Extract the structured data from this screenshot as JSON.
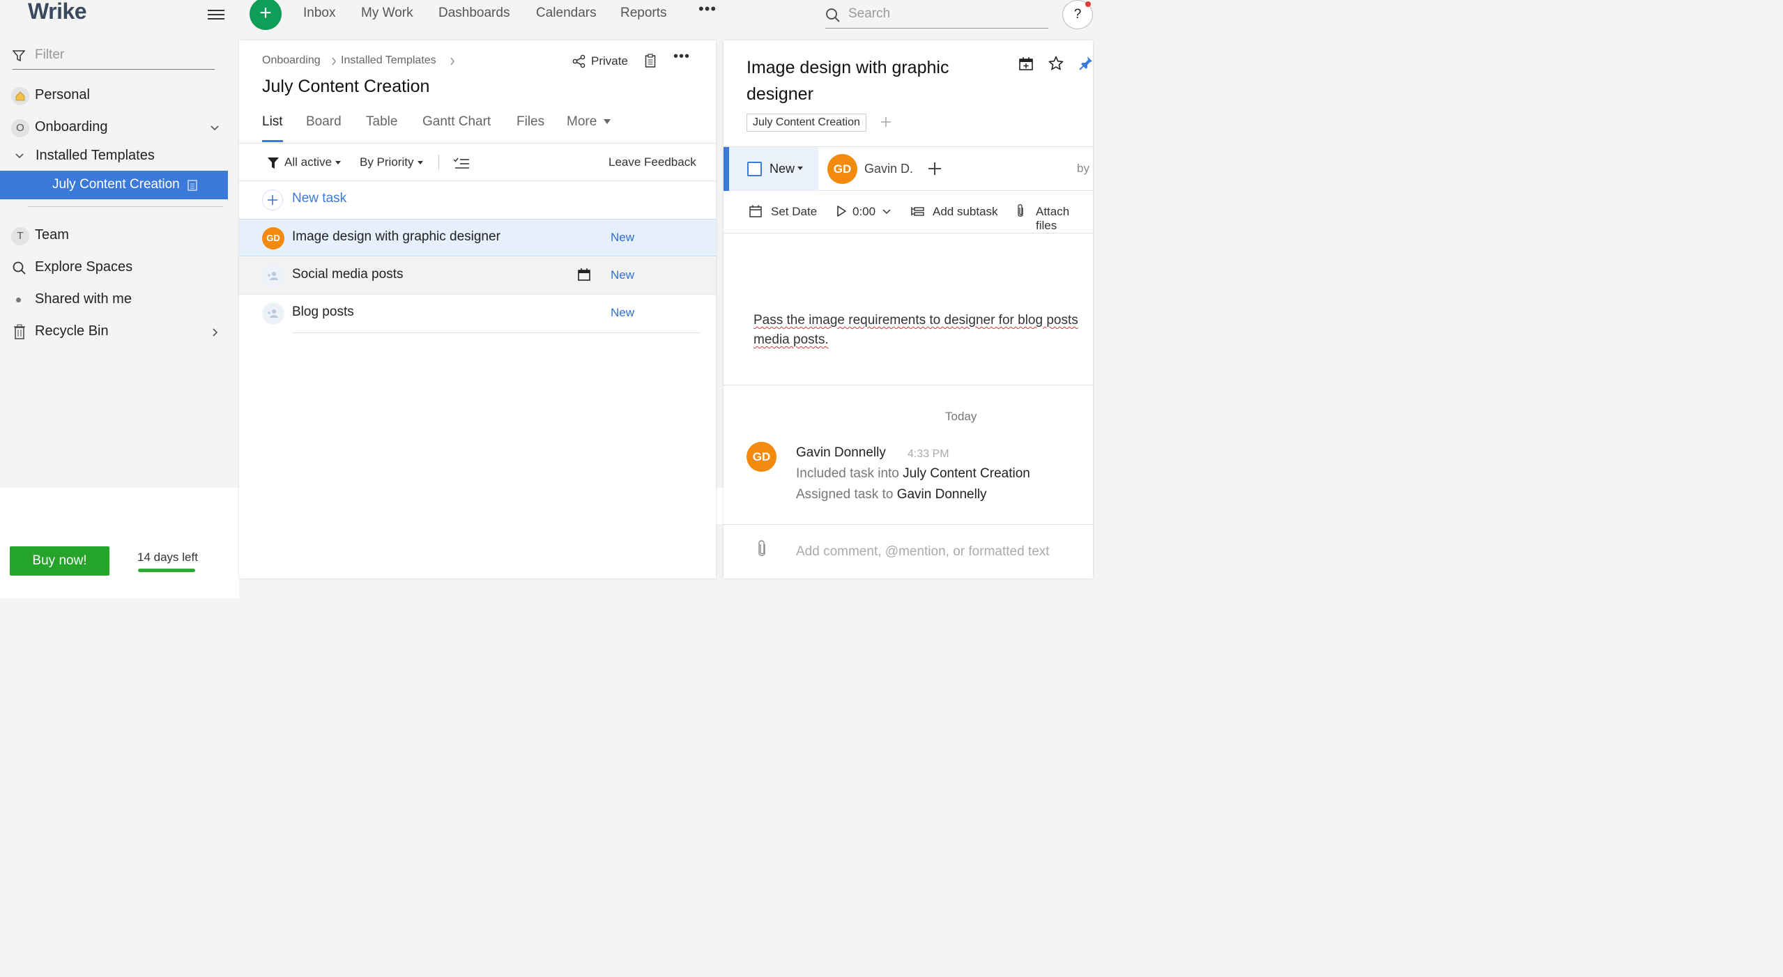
{
  "app": {
    "logo": "Wrike"
  },
  "topnav": {
    "items": [
      "Inbox",
      "My Work",
      "Dashboards",
      "Calendars",
      "Reports"
    ],
    "more": "•••",
    "search_placeholder": "Search",
    "help": "?"
  },
  "sidebar": {
    "filter_placeholder": "Filter",
    "personal": "Personal",
    "onboarding": {
      "letter": "O",
      "label": "Onboarding"
    },
    "installed_templates": "Installed Templates",
    "selected": "July Content Creation",
    "team": {
      "letter": "T",
      "label": "Team"
    },
    "explore": "Explore Spaces",
    "shared": "Shared with me",
    "recycle": "Recycle Bin",
    "buy_now": "Buy now!",
    "days_left": "14 days left",
    "trial_remaining_fraction": 0.55
  },
  "folder": {
    "breadcrumb": [
      "Onboarding",
      "Installed Templates"
    ],
    "title": "July Content Creation",
    "privacy": "Private",
    "tabs": [
      "List",
      "Board",
      "Table",
      "Gantt Chart",
      "Files",
      "More"
    ],
    "active_tab": "List",
    "filter_status": "All active",
    "sort": "By Priority",
    "feedback": "Leave Feedback",
    "new_task": "New task",
    "tasks": [
      {
        "title": "Image design with graphic designer",
        "status": "New",
        "assignee_initials": "GD"
      },
      {
        "title": "Social media posts",
        "status": "New"
      },
      {
        "title": "Blog posts",
        "status": "New"
      }
    ]
  },
  "task": {
    "title": "Image design with graphic designer",
    "tag": "July Content Creation",
    "status": "New",
    "assignee_initials": "GD",
    "assignee_name": "Gavin D.",
    "by_label": "by",
    "set_date": "Set Date",
    "time": "0:00",
    "add_subtask": "Add subtask",
    "attach": "Attach files",
    "description_line1": "Pass the image requirements to designer for blog posts",
    "description_line2": "media posts.",
    "stream_day": "Today",
    "activity": {
      "author": "Gavin Donnelly",
      "initials": "GD",
      "time": "4:33 PM",
      "line1_prefix": "Included task into",
      "line1_target": "July Content Creation",
      "line2_prefix": "Assigned task to",
      "line2_target": "Gavin Donnelly"
    },
    "comment_placeholder": "Add comment, @mention, or formatted text"
  },
  "colors": {
    "accent": "#3b7ad9",
    "brand_green": "#0f9d58",
    "buy_green": "#24a428",
    "avatar_orange": "#f28a0e",
    "status_blue": "#2f6fd0"
  }
}
